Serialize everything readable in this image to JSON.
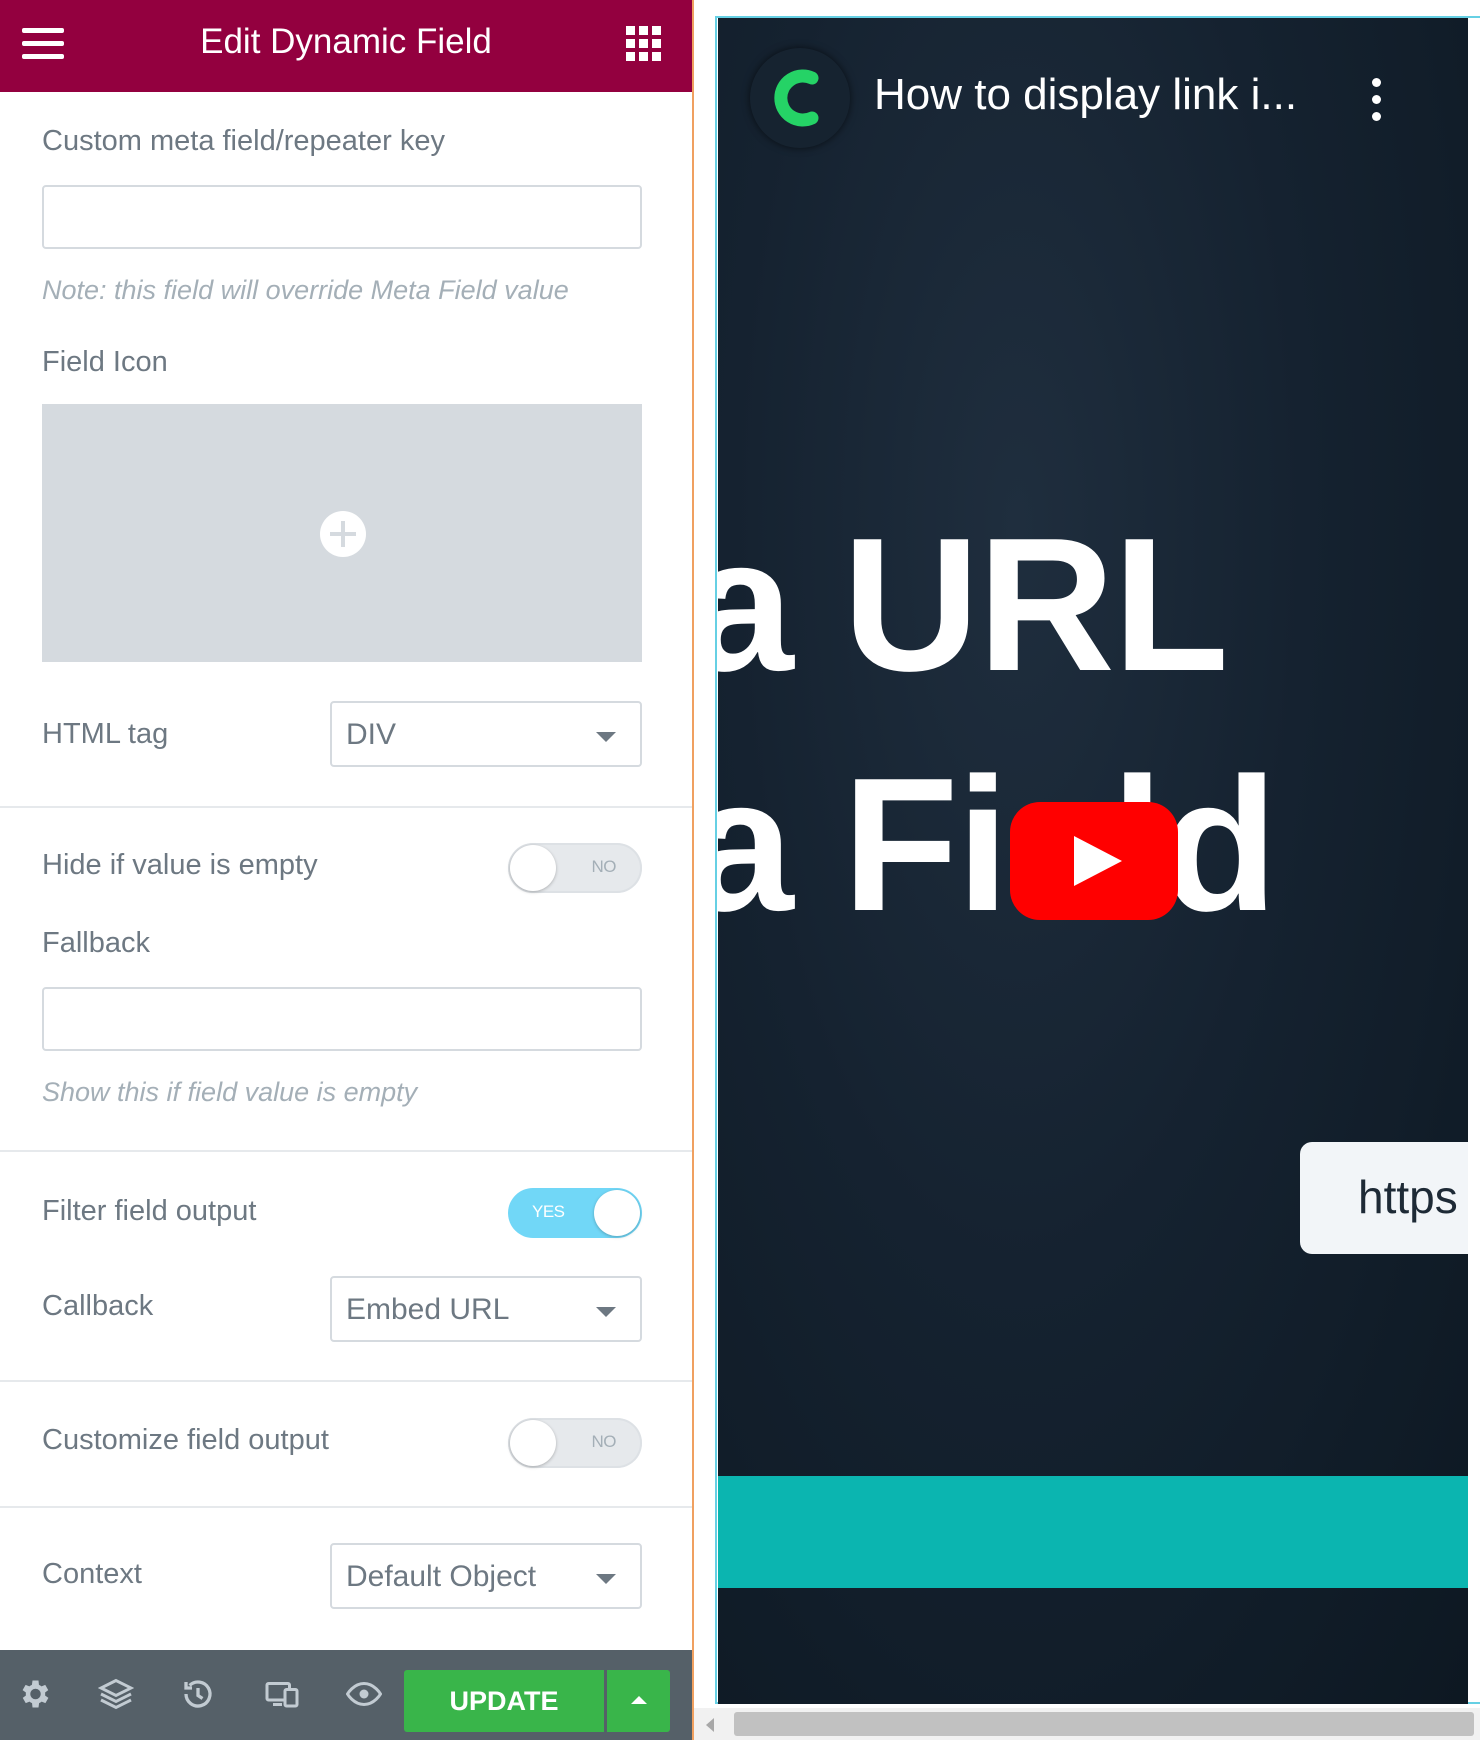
{
  "header": {
    "title": "Edit Dynamic Field",
    "menu_icon": "hamburger-icon",
    "widgets_icon": "grid-icon",
    "background": "#93003f"
  },
  "fields": {
    "custom_meta": {
      "label": "Custom meta field/repeater key",
      "value": "",
      "note": "Note: this field will override Meta Field value"
    },
    "field_icon": {
      "label": "Field Icon",
      "add_icon": "plus-circle-icon"
    },
    "html_tag": {
      "label": "HTML tag",
      "value": "DIV"
    },
    "hide_if_empty": {
      "label": "Hide if value is empty",
      "state": "NO"
    },
    "fallback": {
      "label": "Fallback",
      "value": "",
      "note": "Show this if field value is empty"
    },
    "filter_output": {
      "label": "Filter field output",
      "state": "YES"
    },
    "callback": {
      "label": "Callback",
      "value": "Embed URL"
    },
    "customize_output": {
      "label": "Customize field output",
      "state": "NO"
    },
    "context": {
      "label": "Context",
      "value": "Default Object"
    }
  },
  "footer": {
    "icons": [
      "gear-icon",
      "layers-icon",
      "history-icon",
      "responsive-icon",
      "eye-icon"
    ],
    "update_label": "UPDATE",
    "update_color": "#39b54a"
  },
  "preview": {
    "video_title": "How to display link i...",
    "big_text_line1": "a URL",
    "big_text_line2": "a Field",
    "url_snippet": "https",
    "accent_teal": "#0bb5b0",
    "play_button_color": "#ff0000"
  }
}
